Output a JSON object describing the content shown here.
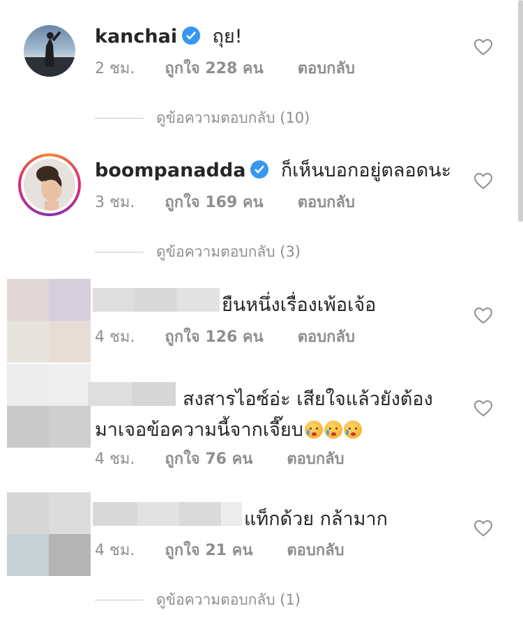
{
  "comments": [
    {
      "username": "kanchai",
      "verified": true,
      "text": "ถุย!",
      "time": "2 ชม.",
      "likes": "ถูกใจ 228 คน",
      "reply": "ตอบกลับ"
    },
    {
      "username": "boompanadda",
      "verified": true,
      "text": "ก็เห็นบอกอยู่ตลอดนะ",
      "time": "3 ชม.",
      "likes": "ถูกใจ 169 คน",
      "reply": "ตอบกลับ"
    },
    {
      "username": "",
      "text": "ยืนหนึ่งเรื่องเพ้อเจ้อ",
      "time": "4 ชม.",
      "likes": "ถูกใจ 126 คน",
      "reply": "ตอบกลับ"
    },
    {
      "username": "",
      "text_line1": "สงสารไอซ์อ่ะ เสียใจแล้วยังต้อง",
      "text_line2": "มาเจอข้อความนี้จากเจี๊ยบ",
      "time": "4 ชม.",
      "likes": "ถูกใจ 76 คน",
      "reply": "ตอบกลับ"
    },
    {
      "username": "",
      "text": "แท็กด้วย กล้ามาก",
      "time": "4 ชม.",
      "likes": "ถูกใจ 21 คน",
      "reply": "ตอบกลับ"
    }
  ],
  "view_replies": [
    "ดูข้อความตอบกลับ (10)",
    "ดูข้อความตอบกลับ (3)",
    "ดูข้อความตอบกลับ (1)"
  ],
  "icons": {
    "heart": "heart-outline-icon",
    "verified": "verified-badge-icon",
    "emoji": "crying-face-emoji"
  },
  "colors": {
    "text": "#262626",
    "meta": "#8e8e8e",
    "verified_blue": "#3897f0",
    "story_ring": "#e1306c"
  }
}
